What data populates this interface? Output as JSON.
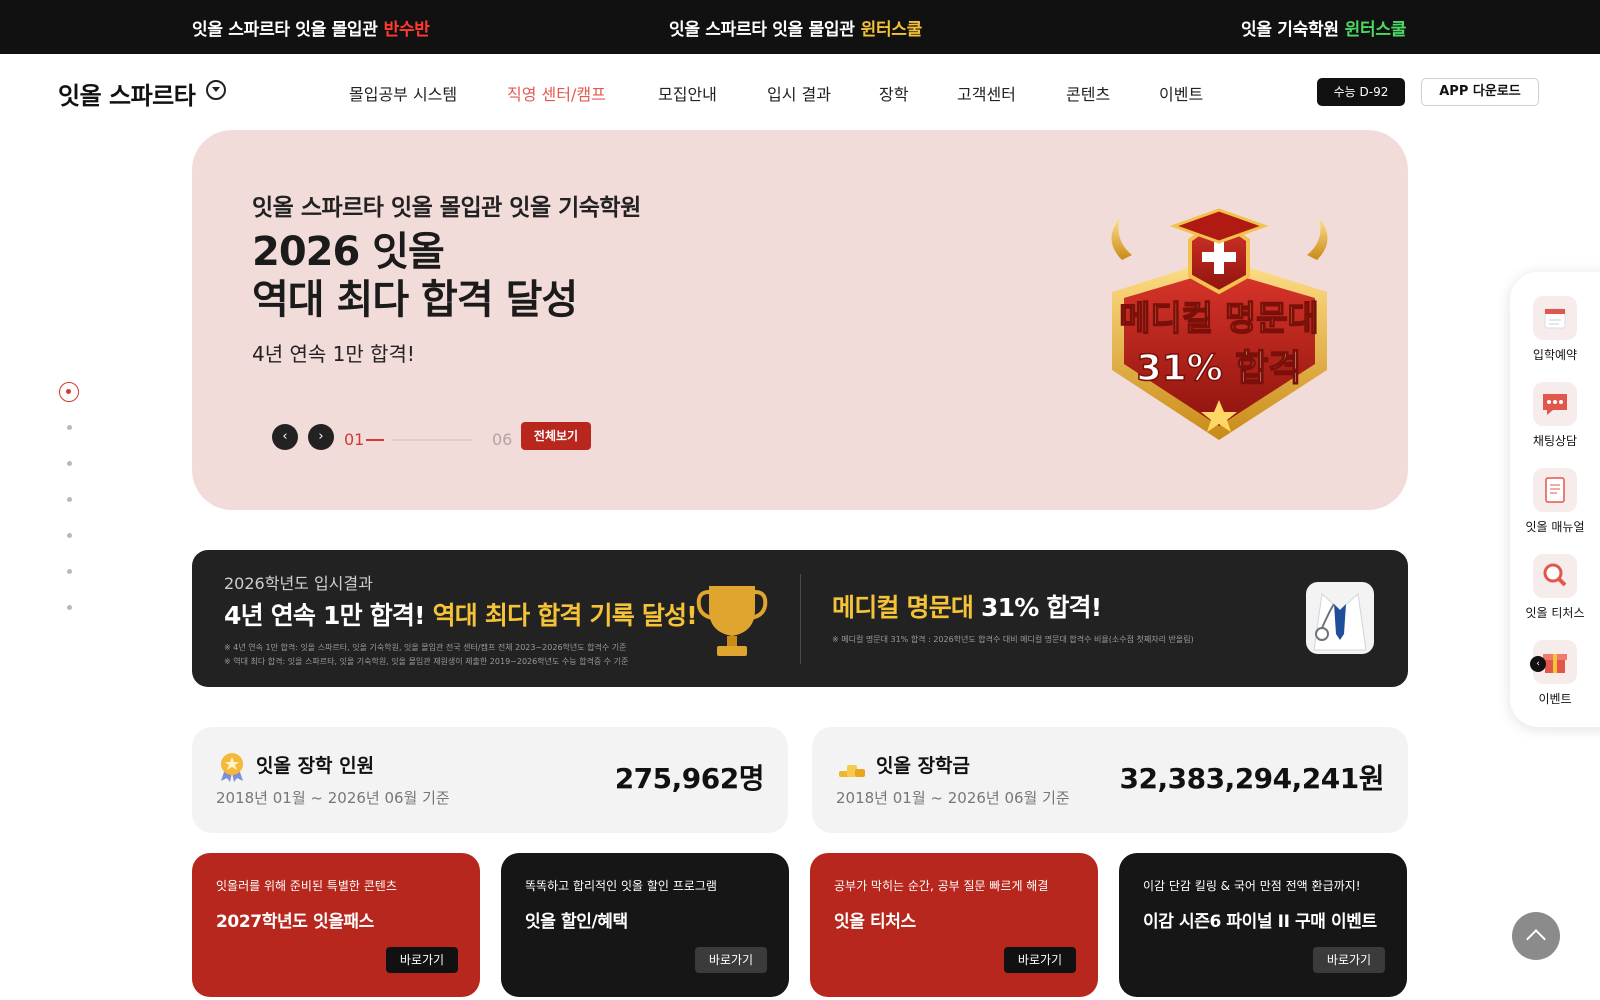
{
  "topbar": {
    "items": [
      {
        "label": "잇올 스파르타 잇올 몰입관",
        "tag": "반수반",
        "tag_color": "#ff3b30"
      },
      {
        "label": "잇올 스파르타 잇올 몰입관",
        "tag": "윈터스쿨",
        "tag_color": "#f5c338"
      },
      {
        "label": "잇올 기숙학원",
        "tag": "윈터스쿨",
        "tag_color": "#4cd964"
      }
    ]
  },
  "header": {
    "logo": "잇올 스파르타",
    "nav": [
      "몰입공부 시스템",
      "직영 센터/캠프",
      "모집안내",
      "입시 결과",
      "장학",
      "고객센터",
      "콘텐츠",
      "이벤트"
    ],
    "active_nav_index": 1,
    "dday": "수능 D-92",
    "app_download": "APP 다운로드"
  },
  "hero": {
    "brands": "잇올 스파르타  잇올 몰입관  잇올 기숙학원",
    "title_line1": "2026 잇올",
    "title_line2": "역대 최다 합격 달성",
    "subtitle": "4년 연속 1만 합격!",
    "current_slide": "01",
    "total_slides": "06",
    "view_all": "전체보기",
    "emblem_line1": "메디컬 명문대",
    "emblem_line2": "31% 합격",
    "background": "#f2dcda"
  },
  "results": {
    "year_label": "2026학년도 입시결과",
    "headline_white": "4년 연속 1만 합격!",
    "headline_yellow": "역대 최다 합격 기록 달성!",
    "footnote1": "※ 4년 연속 1만 합격: 잇올 스파르타, 잇올 기숙학원, 잇올 몰입관 전국 센터/캠프 전체 2023~2026학년도 합격수 기준",
    "footnote2": "※ 역대 최다 합격: 잇올 스파르타, 잇올 기숙학원, 잇올 몰입관 재원생이 제출한 2019~2026학년도 수능 합격증 수 기준",
    "medical_yellow": "메디컬 명문대",
    "medical_white": "31% 합격!",
    "medical_footnote": "※ 메디컬 명문대 31% 합격 : 2026학년도 합격수 대비 메디컬 명문대 합격수 비율(소수점 첫째자리 반올림)"
  },
  "stats": [
    {
      "label": "잇올 장학 인원",
      "period": "2018년 01월 ~ 2026년 06월 기준",
      "value": "275,962명",
      "icon": "medal-icon"
    },
    {
      "label": "잇올 장학금",
      "period": "2018년 01월 ~ 2026년 06월 기준",
      "value": "32,383,294,241원",
      "icon": "coins-icon"
    }
  ],
  "promos": [
    {
      "desc": "잇올러를 위해 준비된 특별한 콘텐츠",
      "title": "2027학년도 잇올패스",
      "button": "바로가기",
      "theme": "red"
    },
    {
      "desc": "똑똑하고 합리적인 잇올 할인 프로그램",
      "title": "잇올 할인/혜택",
      "button": "바로가기",
      "theme": "black"
    },
    {
      "desc": "공부가 막히는 순간, 공부 질문 빠르게 해결",
      "title": "잇올 티처스",
      "button": "바로가기",
      "theme": "red"
    },
    {
      "desc": "이감 단감 킬링 & 국어 만점 전액 환급까지!",
      "title": "이감 시즌6 파이널 II  구매 이벤트",
      "button": "바로가기",
      "theme": "black"
    }
  ],
  "quick_menu": [
    {
      "label": "입학예약",
      "icon": "calendar-icon"
    },
    {
      "label": "채팅상담",
      "icon": "chat-icon"
    },
    {
      "label": "잇올 매뉴얼",
      "icon": "manual-icon"
    },
    {
      "label": "잇올 티처스",
      "icon": "teacher-search-icon"
    },
    {
      "label": "이벤트",
      "icon": "gift-icon"
    }
  ],
  "colors": {
    "accent_red": "#b8271d",
    "highlight_yellow": "#f5c338",
    "nav_active": "#e35a4f"
  }
}
